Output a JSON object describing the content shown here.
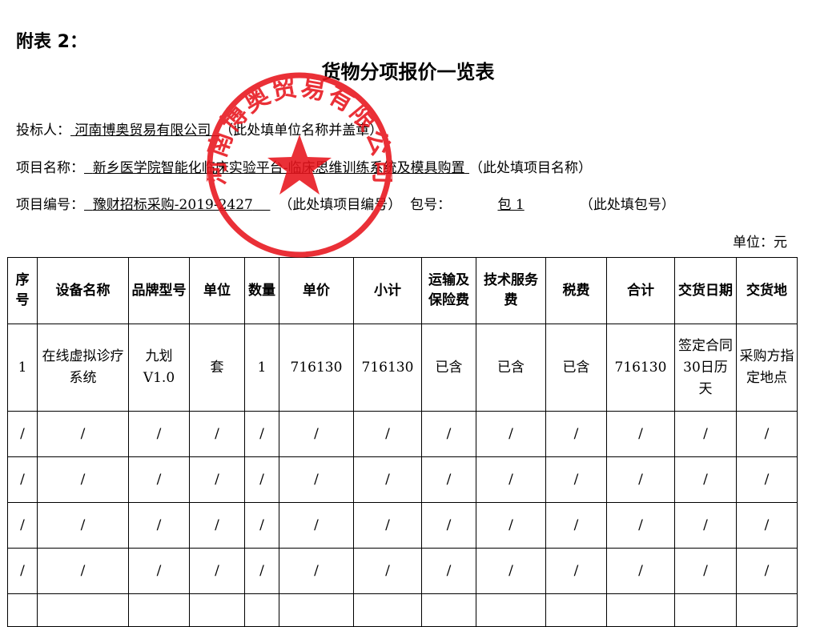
{
  "appendix": "附表 2：",
  "title": "货物分项报价一览表",
  "bidder": {
    "label": "投标人：",
    "value": "河南博奥贸易有限公司",
    "note": "（此处填单位名称并盖章）"
  },
  "project_name": {
    "label": "项目名称：",
    "value": "新乡医学院智能化临床实验平台-临床思维训练系统及模具购置",
    "note": "（此处填项目名称）"
  },
  "project_no": {
    "label": "项目编号：",
    "value": "豫财招标采购-2019-2427",
    "note": "（此处填项目编号）"
  },
  "package": {
    "label": "包号：",
    "value": "包 1",
    "note": "（此处填包号）"
  },
  "unit": "单位：元",
  "table": {
    "headers": [
      "序号",
      "设备名称",
      "品牌型号",
      "单位",
      "数量",
      "单价",
      "小计",
      "运输及保险费",
      "技术服务费",
      "税费",
      "合计",
      "交货日期",
      "交货地"
    ],
    "rows": [
      [
        "1",
        "在线虚拟诊疗系统",
        "九划V1.0",
        "套",
        "1",
        "716130",
        "716130",
        "已含",
        "已含",
        "已含",
        "716130",
        "签定合同30日历天",
        "采购方指定地点"
      ],
      [
        "/",
        "/",
        "/",
        "/",
        "/",
        "/",
        "/",
        "/",
        "/",
        "/",
        "/",
        "/",
        "/"
      ],
      [
        "/",
        "/",
        "/",
        "/",
        "/",
        "/",
        "/",
        "/",
        "/",
        "/",
        "/",
        "/",
        "/"
      ],
      [
        "/",
        "/",
        "/",
        "/",
        "/",
        "/",
        "/",
        "/",
        "/",
        "/",
        "/",
        "/",
        "/"
      ],
      [
        "/",
        "/",
        "/",
        "/",
        "/",
        "/",
        "/",
        "/",
        "/",
        "/",
        "/",
        "/",
        "/"
      ]
    ]
  },
  "seal": {
    "text": "河南博奥贸易有限公司",
    "color": "#e8141c"
  }
}
